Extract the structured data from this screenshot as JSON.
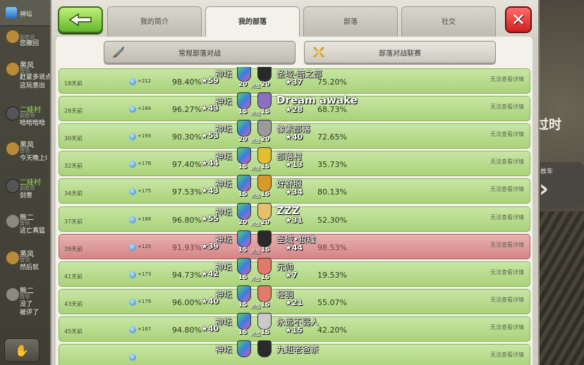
{
  "chat": {
    "header_label": "神坛",
    "messages": [
      {
        "name": "",
        "role": "副首领",
        "text": "您撤回"
      },
      {
        "name": "黑风",
        "role": "首领",
        "text": "赶紧多说点",
        "text2": "这玩意出"
      },
      {
        "name": "二娃村",
        "role": "副首领",
        "text": "哈哈哈哈"
      },
      {
        "name": "黑风",
        "role": "首领",
        "text": "今天晚上I"
      },
      {
        "name": "二娃村",
        "role": "副首领",
        "text": "剑意"
      },
      {
        "name": "熊二",
        "role": "首领",
        "text": "这亡真猛"
      },
      {
        "name": "黑风",
        "role": "首领",
        "text": "然后就"
      },
      {
        "name": "熊二",
        "role": "首领",
        "text": "没了",
        "text2": "被评了"
      }
    ]
  },
  "tabs": [
    {
      "label": "我的简介"
    },
    {
      "label": "我的部落"
    },
    {
      "label": "部落"
    },
    {
      "label": "社交"
    }
  ],
  "segments": {
    "regular_war": "常规部落对战",
    "war_league": "部落对战联赛"
  },
  "scenery": {
    "title_fragment": "过时",
    "box_label": "故车"
  },
  "wars": [
    {
      "date": "18天前",
      "trophies": "+212",
      "pct": "98.40%",
      "stars": "59",
      "me": "神坛",
      "size1": "20",
      "vs": "对战",
      "size2": "20",
      "opp": "圣域-暗之部",
      "ostars": "37",
      "opct": "75.20%",
      "view": "无法查看详情",
      "result": "win",
      "ocolor": "#2a2a2a"
    },
    {
      "date": "28天前",
      "trophies": "+164",
      "pct": "96.27%",
      "stars": "43",
      "me": "神坛",
      "size1": "15",
      "vs": "对战",
      "size2": "15",
      "opp": "Dream awake",
      "ostars": "28",
      "opct": "68.73%",
      "view": "无法查看详情",
      "result": "win",
      "ocolor": "#8b6fc0"
    },
    {
      "date": "30天前",
      "trophies": "+193",
      "pct": "90.30%",
      "stars": "53",
      "me": "神坛",
      "size1": "20",
      "vs": "对战",
      "size2": "20",
      "opp": "像素部落",
      "ostars": "40",
      "opct": "72.65%",
      "view": "无法查看详情",
      "result": "win",
      "ocolor": "#9a9a9a"
    },
    {
      "date": "32天前",
      "trophies": "+176",
      "pct": "97.40%",
      "stars": "44",
      "me": "神坛",
      "size1": "15",
      "vs": "对战",
      "size2": "15",
      "opp": "部落村",
      "ostars": "13",
      "opct": "35.73%",
      "view": "无法查看详情",
      "result": "win",
      "ocolor": "#e0c030"
    },
    {
      "date": "34天前",
      "trophies": "+175",
      "pct": "97.53%",
      "stars": "43",
      "me": "神坛",
      "size1": "15",
      "vs": "对战",
      "size2": "15",
      "opp": "好舒服",
      "ostars": "34",
      "opct": "80.13%",
      "view": "无法查看详情",
      "result": "win",
      "ocolor": "#d99a2a"
    },
    {
      "date": "37天前",
      "trophies": "+188",
      "pct": "96.80%",
      "stars": "55",
      "me": "神坛",
      "size1": "20",
      "vs": "对战",
      "size2": "20",
      "opp": "ZZZ",
      "ostars": "31",
      "opct": "52.30%",
      "view": "无法查看详情",
      "result": "win",
      "ocolor": "#e6c06a"
    },
    {
      "date": "39天前",
      "trophies": "+125",
      "pct": "91.93%",
      "stars": "39",
      "me": "神坛",
      "size1": "15",
      "vs": "对战",
      "size2": "15",
      "opp": "圣域•狼魂",
      "ostars": "44",
      "opct": "98.53%",
      "view": "无法查看详情",
      "result": "lose",
      "ocolor": "#2a2a2a"
    },
    {
      "date": "41天前",
      "trophies": "+173",
      "pct": "94.73%",
      "stars": "42",
      "me": "神坛",
      "size1": "15",
      "vs": "对战",
      "size2": "15",
      "opp": "元帅",
      "ostars": "7",
      "opct": "19.53%",
      "view": "无法查看详情",
      "result": "win",
      "ocolor": "#e07a6a"
    },
    {
      "date": "43天前",
      "trophies": "+179",
      "pct": "96.00%",
      "stars": "40",
      "me": "神坛",
      "size1": "15",
      "vs": "对战",
      "size2": "15",
      "opp": "轻羽",
      "ostars": "21",
      "opct": "55.07%",
      "view": "无法查看详情",
      "result": "win",
      "ocolor": "#e07a6a"
    },
    {
      "date": "45天前",
      "trophies": "+167",
      "pct": "94.80%",
      "stars": "40",
      "me": "神坛",
      "size1": "15",
      "vs": "对战",
      "size2": "15",
      "opp": "永远不弱人",
      "ostars": "15",
      "opct": "42.20%",
      "view": "无法查看详情",
      "result": "win",
      "ocolor": "#c9c9c9"
    },
    {
      "date": "",
      "trophies": "",
      "pct": "",
      "stars": "",
      "me": "神坛",
      "size1": "",
      "vs": "",
      "size2": "",
      "opp": "九班老爸茶",
      "ostars": "",
      "opct": "",
      "view": "无法查看详情",
      "result": "win",
      "ocolor": "#2a2a2a"
    }
  ]
}
